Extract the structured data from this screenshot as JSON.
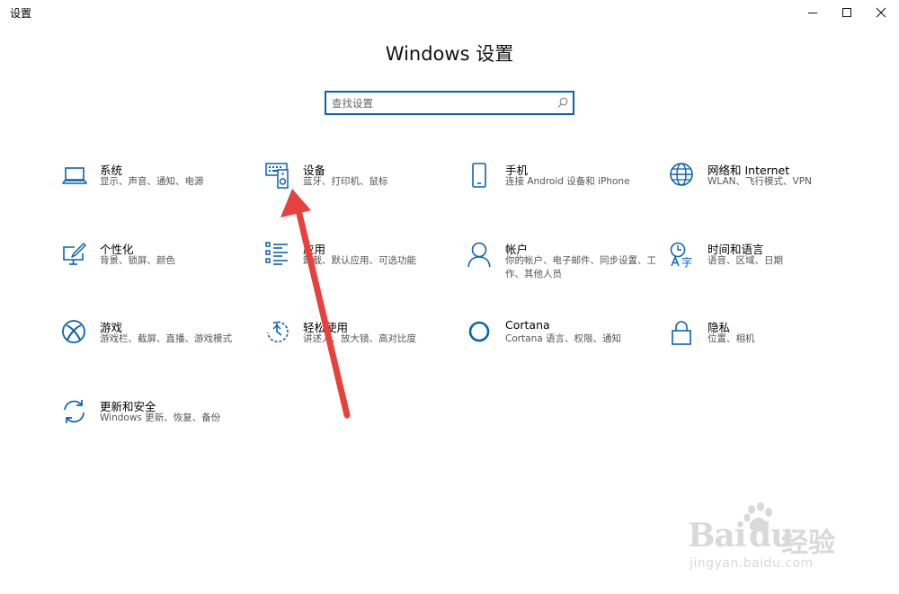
{
  "window": {
    "title": "设置"
  },
  "header": {
    "title": "Windows 设置"
  },
  "search": {
    "placeholder": "查找设置"
  },
  "colors": {
    "accent": "#0a62b4",
    "arrow": "#e8403a"
  },
  "tiles": [
    {
      "id": "system",
      "icon": "laptop-icon",
      "name": "系统",
      "desc": "显示、声音、通知、电源"
    },
    {
      "id": "devices",
      "icon": "keyboard-speaker-icon",
      "name": "设备",
      "desc": "蓝牙、打印机、鼠标"
    },
    {
      "id": "phone",
      "icon": "phone-icon",
      "name": "手机",
      "desc": "连接 Android 设备和 iPhone"
    },
    {
      "id": "network",
      "icon": "globe-icon",
      "name": "网络和 Internet",
      "desc": "WLAN、飞行模式、VPN"
    },
    {
      "id": "personalization",
      "icon": "paint-screen-icon",
      "name": "个性化",
      "desc": "背景、锁屏、颜色"
    },
    {
      "id": "apps",
      "icon": "app-list-icon",
      "name": "应用",
      "desc": "卸载、默认应用、可选功能"
    },
    {
      "id": "accounts",
      "icon": "person-icon",
      "name": "帐户",
      "desc": "你的帐户、电子邮件、同步设置、工作、其他人员"
    },
    {
      "id": "time-language",
      "icon": "time-language-icon",
      "name": "时间和语言",
      "desc": "语音、区域、日期"
    },
    {
      "id": "gaming",
      "icon": "xbox-icon",
      "name": "游戏",
      "desc": "游戏栏、截屏、直播、游戏模式"
    },
    {
      "id": "ease-of-access",
      "icon": "ease-of-access-icon",
      "name": "轻松使用",
      "desc": "讲述人、放大镜、高对比度"
    },
    {
      "id": "cortana",
      "icon": "cortana-icon",
      "name": "Cortana",
      "desc": "Cortana 语言、权限、通知"
    },
    {
      "id": "privacy",
      "icon": "lock-icon",
      "name": "隐私",
      "desc": "位置、相机"
    },
    {
      "id": "update-security",
      "icon": "sync-icon",
      "name": "更新和安全",
      "desc": "Windows 更新、恢复、备份"
    }
  ],
  "watermark": {
    "brand": "Bai",
    "brand2": "du",
    "cn": "经验",
    "url": "jingyan.baidu.com"
  }
}
